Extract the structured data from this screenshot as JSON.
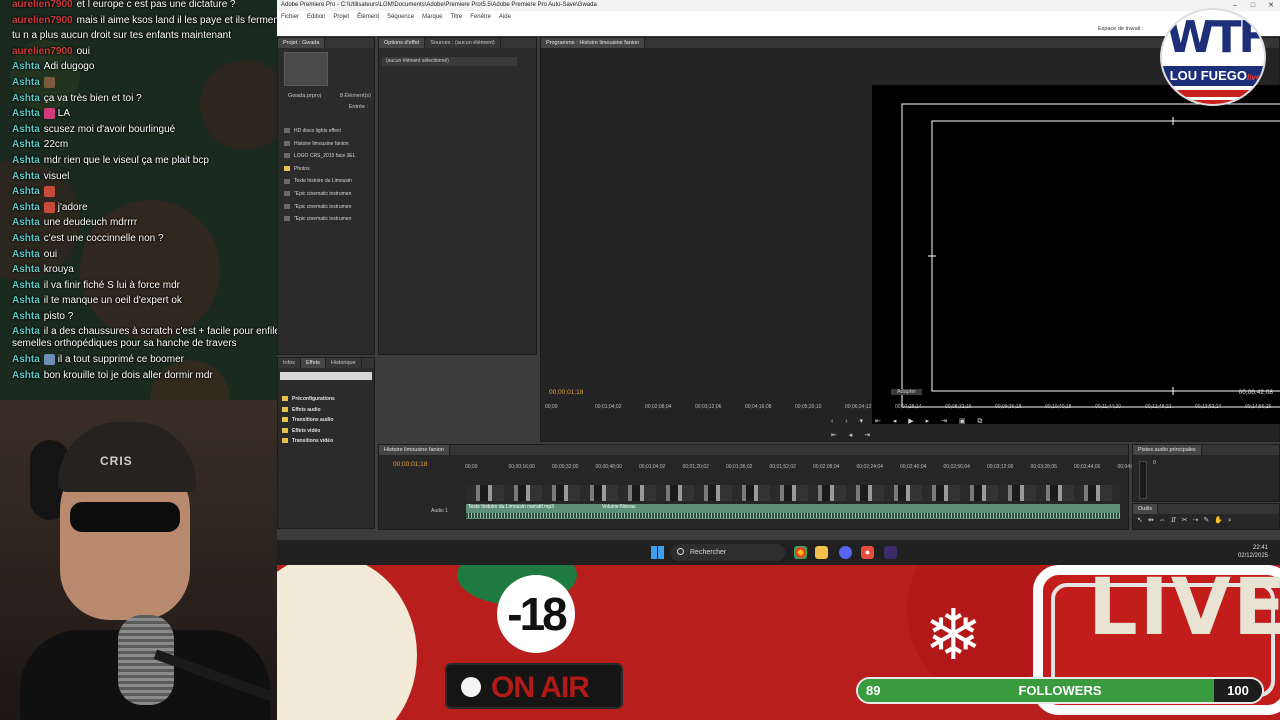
{
  "chat": {
    "messages": [
      {
        "user": "aurelien7900",
        "text": "et l europe c est pas une dictature ?",
        "wrap": false
      },
      {
        "user": "aurelien7900",
        "text": "mais il aime ksos land il les paye et ils ferment leur gueules",
        "wrap": false
      },
      {
        "user": "",
        "text": "tu n a plus aucun droit sur tes enfants maintenant",
        "wrap": false
      },
      {
        "user": "aurelien7900",
        "text": "oui",
        "wrap": false
      },
      {
        "user": "Ashta",
        "text": "Adi dugogo",
        "wrap": false
      },
      {
        "user": "Ashta",
        "text": "",
        "emote": "#7a5a3a",
        "wrap": false
      },
      {
        "user": "Ashta",
        "text": "ça va très bien et toi ?",
        "wrap": false
      },
      {
        "user": "Ashta",
        "text": "LA",
        "emote": "#d13b7a",
        "wrap": false
      },
      {
        "user": "Ashta",
        "text": "scusez moi d'avoir bourlingué",
        "wrap": false
      },
      {
        "user": "Ashta",
        "text": "22cm",
        "wrap": false
      },
      {
        "user": "Ashta",
        "text": "mdr rien que le viseul ça me plait bcp",
        "wrap": false
      },
      {
        "user": "Ashta",
        "text": "visuel",
        "wrap": false
      },
      {
        "user": "Ashta",
        "text": "",
        "emote": "#c84a3a",
        "wrap": false
      },
      {
        "user": "Ashta",
        "text": "j'adore",
        "emote": "#c84a3a",
        "wrap": false
      },
      {
        "user": "Ashta",
        "text": "une deudeuch mdrrrr",
        "wrap": false
      },
      {
        "user": "Ashta",
        "text": "c'est une coccinnelle non ?",
        "wrap": false
      },
      {
        "user": "Ashta",
        "text": "oui",
        "wrap": false
      },
      {
        "user": "Ashta",
        "text": "krouya",
        "wrap": false
      },
      {
        "user": "Ashta",
        "text": "il va finir fiché S lui à force mdr",
        "wrap": false
      },
      {
        "user": "Ashta",
        "text": "il te manque un oeil d'expert ok",
        "wrap": false
      },
      {
        "user": "Ashta",
        "text": "pisto ?",
        "wrap": false
      },
      {
        "user": "Ashta",
        "text": "il a des chaussures à scratch c'est + facile pour enfiler ses semelles orthopédiques pour sa hanche de travers",
        "wrap": true
      },
      {
        "user": "Ashta",
        "text": "il a tout supprimé ce boomer",
        "emote": "#6b8fb5",
        "wrap": false
      },
      {
        "user": "Ashta",
        "text": "bon krouille toi je dois aller dormir mdr",
        "wrap": false
      }
    ]
  },
  "webcam": {
    "cap_text": "CRIS"
  },
  "premiere": {
    "window_title": "Adobe Premiere Pro - C:\\Utilisateurs\\LGM\\Documents\\Adobe\\Premiere Pro\\5.5\\Adobe Premiere Pro Auto-Save\\Gwada",
    "menu": [
      "Fichier",
      "Edition",
      "Projet",
      "Élément",
      "Séquence",
      "Marque",
      "Titre",
      "Fenêtre",
      "Aide"
    ],
    "workspace_label": "Espace de travail :",
    "project_tab": "Projet : Gwada",
    "project_file": "Gwada.prproj",
    "project_count": "8 Élément(s)",
    "project_entry": "Entrée :",
    "project_items": [
      {
        "label": "HD disco lights effect",
        "folder": false
      },
      {
        "label": "Histoire limousine fanion",
        "folder": false
      },
      {
        "label": "LOGO CRS_2015 face 3EL",
        "folder": false
      },
      {
        "label": "Photos",
        "folder": true
      },
      {
        "label": "Texte histoire du Limousin",
        "folder": false
      },
      {
        "label": "\"Epic cinematic instrumen",
        "folder": false
      },
      {
        "label": "\"Epic cinematic instrumen",
        "folder": false
      },
      {
        "label": "\"Epic cinematic instrumen",
        "folder": false
      }
    ],
    "effect_tabs": [
      "Options d'effet",
      "Sources : (aucun élément)"
    ],
    "effect_selected": "(aucun élément sélectionné)",
    "effects_tabs": [
      "Infos",
      "Effets",
      "Historique"
    ],
    "effects_items": [
      "Préconfigurations",
      "Effets audio",
      "Transitions audio",
      "Effets vidéo",
      "Transitions vidéo"
    ],
    "program_tab": "Programme : Histoire limousine fanion",
    "program_timecode": "00;00;01;18",
    "program_duration": "00;06;42;08",
    "program_fit": "Adapter",
    "program_ruler": [
      "00;00",
      "00;01;04;02",
      "00;02;08;04",
      "00;03;12;06",
      "00;04;16;08",
      "00;05;20;10",
      "00;06;24;12",
      "00;07;28;14",
      "00;08;32;16",
      "00;09;36;18",
      "00;10;40;18",
      "00;11;44;20",
      "00;12;48;22",
      "00;13;52;24",
      "00;14;56;26"
    ],
    "sequence_tab": "Histoire limousine fanion",
    "sequence_timecode": "00;00;01;18",
    "sequence_ruler": [
      "00;00",
      "00;00;16;00",
      "00;00;32;00",
      "00;00;48;00",
      "00;01;04;02",
      "00;01;20;02",
      "00;01;36;02",
      "00;01;52;02",
      "00;02;08;04",
      "00;02;24;04",
      "00;02;40;04",
      "00;02;56;04",
      "00;03;12;06",
      "00;03;28;06",
      "00;03;44;06",
      "00;04;0"
    ],
    "audio_track_label": "Audio 1",
    "audio_clip": "Texte histoire du Limousin narratif.mp3",
    "audio_clip_fx": "Volume:Niveau",
    "audio_master_tab": "Pistes audio principales",
    "audio_meter_top": "0",
    "tools_tab": "Outils"
  },
  "taskbar": {
    "search": "Rechercher",
    "time": "22:41",
    "date": "02/12/2025"
  },
  "overlay": {
    "age": "-18",
    "onair": "ON AIR",
    "live": "LIVE",
    "followers_current": "89",
    "followers_label": "FOLLOWERS",
    "followers_goal": "100",
    "followers_progress": 0.89,
    "logo_top": "WTF",
    "logo_name": "LOU FUEGO",
    "logo_tag": "live"
  }
}
